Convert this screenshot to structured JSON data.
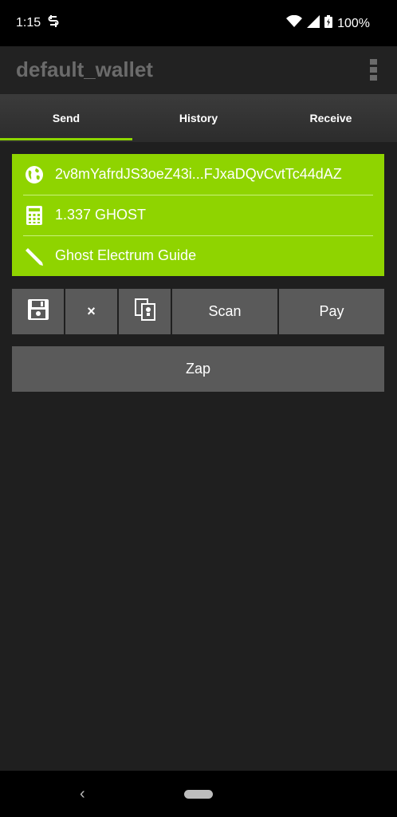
{
  "status": {
    "time": "1:15",
    "battery": "100%"
  },
  "app": {
    "title": "default_wallet"
  },
  "tabs": [
    {
      "label": "Send"
    },
    {
      "label": "History"
    },
    {
      "label": "Receive"
    }
  ],
  "send": {
    "address": "2v8mYafrdJS3oeZ43i...FJxaDQvCvtTc44dAZ",
    "amount": "1.337 GHOST",
    "description": "Ghost Electrum Guide"
  },
  "buttons": {
    "scan": "Scan",
    "pay": "Pay",
    "clear": "×",
    "zap": "Zap"
  },
  "colors": {
    "accent": "#8fd400",
    "background": "#1f1f1f",
    "button": "#5a5a5a"
  }
}
